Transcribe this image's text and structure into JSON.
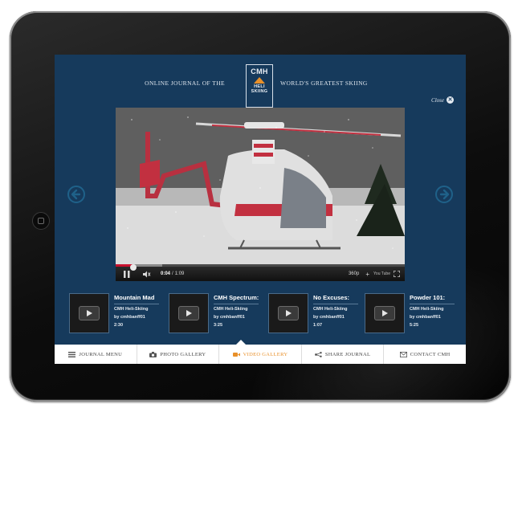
{
  "header": {
    "left_text": "ONLINE JOURNAL OF THE",
    "right_text": "WORLD'S GREATEST SKIING",
    "logo": {
      "line1": "CMH",
      "line2": "HELI",
      "line3": "SKIING"
    }
  },
  "close_label": "Close",
  "video": {
    "current_time": "0:04",
    "separator": "/",
    "duration": "1:09",
    "quality": "360p",
    "youtube_label": "You Tube",
    "progress_fraction": 0.06,
    "buffered_fraction": 0.16
  },
  "playlist": [
    {
      "title": "Mountain Mad",
      "channel": "CMH Heli-Skiing",
      "author": "by cmhbanff01",
      "duration": "2:30"
    },
    {
      "title": "CMH Spectrum:",
      "channel": "CMH Heli-Skiing",
      "author": "by cmhbanff01",
      "duration": "3:25"
    },
    {
      "title": "No Excuses:",
      "channel": "CMH Heli-Skiing",
      "author": "by cmhbanff01",
      "duration": "1:07"
    },
    {
      "title": "Powder 101:",
      "channel": "CMH Heli-Skiing",
      "author": "by cmhbanff01",
      "duration": "5:25"
    }
  ],
  "nav": [
    {
      "label": "JOURNAL MENU",
      "icon": "list-icon",
      "active": false
    },
    {
      "label": "PHOTO GALLERY",
      "icon": "camera-icon",
      "active": false
    },
    {
      "label": "VIDEO GALLERY",
      "icon": "video-camera-icon",
      "active": true
    },
    {
      "label": "SHARE JOURNAL",
      "icon": "share-icon",
      "active": false
    },
    {
      "label": "CONTACT CMH",
      "icon": "envelope-icon",
      "active": false
    }
  ],
  "colors": {
    "screen_bg": "#163a5c",
    "accent": "#e8902a",
    "progress": "#c8102e"
  }
}
